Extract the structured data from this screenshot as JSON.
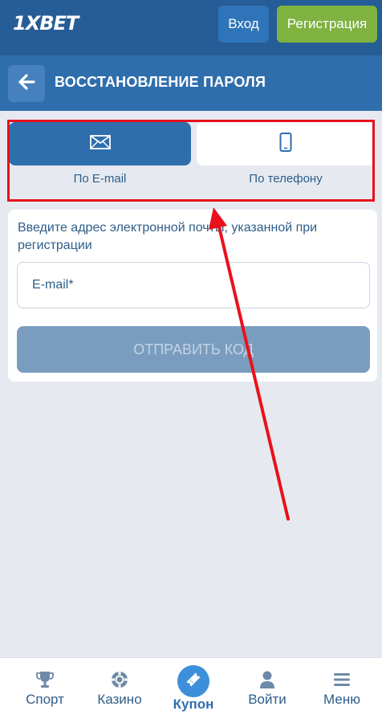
{
  "header": {
    "logo": "1XBET",
    "login_label": "Вход",
    "register_label": "Регистрация",
    "colors": {
      "header_bg": "#265d97",
      "login_bg": "#2f74b8",
      "register_bg": "#7fb241"
    }
  },
  "title_bar": {
    "title": "ВОССТАНОВЛЕНИЕ ПАРОЛЯ",
    "back_icon": "arrow-left-icon"
  },
  "recovery_tabs": [
    {
      "label": "По E-mail",
      "icon": "envelope-icon",
      "selected": true
    },
    {
      "label": "По телефону",
      "icon": "phone-icon",
      "selected": false
    }
  ],
  "form": {
    "hint": "Введите адрес электронной почты, указанной при регистрации",
    "email_placeholder": "E-mail*",
    "email_value": "",
    "submit_label": "ОТПРАВИТЬ КОД",
    "submit_enabled": false
  },
  "annotation": {
    "color": "#e8111c",
    "shapes": [
      "highlight-rectangle",
      "pointer-arrow"
    ]
  },
  "bottom_nav": [
    {
      "label": "Спорт",
      "icon": "trophy-icon"
    },
    {
      "label": "Казино",
      "icon": "poker-chip-icon"
    },
    {
      "label": "Купон",
      "icon": "ticket-icon",
      "active": true
    },
    {
      "label": "Войти",
      "icon": "user-icon"
    },
    {
      "label": "Меню",
      "icon": "hamburger-menu-icon"
    }
  ]
}
